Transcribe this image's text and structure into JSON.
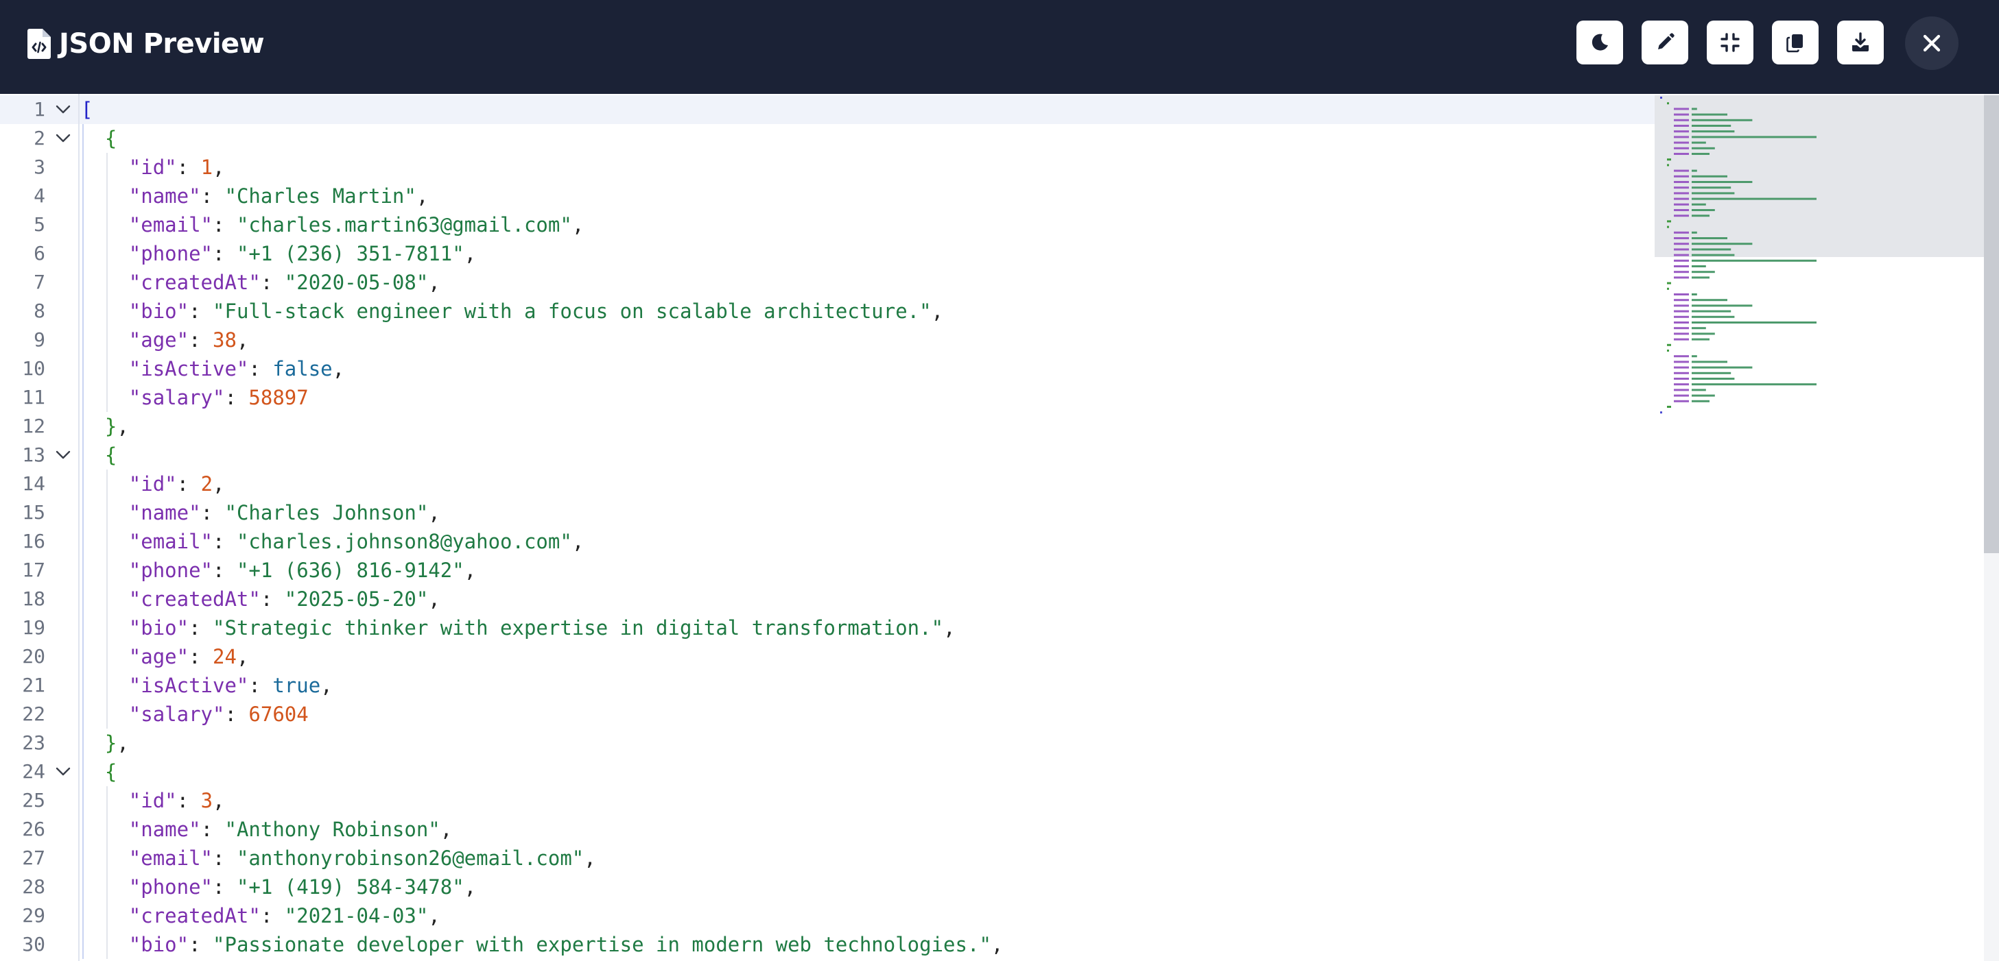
{
  "app": {
    "title": "JSON Preview"
  },
  "toolbar": [
    {
      "name": "theme-toggle-button",
      "icon": "moon-icon"
    },
    {
      "name": "edit-button",
      "icon": "pencil-icon"
    },
    {
      "name": "collapse-button",
      "icon": "compress-icon"
    },
    {
      "name": "copy-button",
      "icon": "copy-icon"
    },
    {
      "name": "download-button",
      "icon": "download-icon"
    }
  ],
  "close": {
    "icon": "close-icon"
  },
  "colors": {
    "header_bg": "#1b2236",
    "key": "#7b2fae",
    "string": "#1f7a43",
    "number": "#d2551c",
    "boolean": "#1a6a9a",
    "brace": "#2a8a2a",
    "bracket": "#2323c8"
  },
  "editor": {
    "lines": [
      {
        "n": "1",
        "fold": true,
        "tokens": [
          {
            "t": "bracket",
            "v": "["
          }
        ]
      },
      {
        "n": "2",
        "fold": true,
        "tokens": [
          {
            "t": "brace",
            "v": "{"
          }
        ]
      },
      {
        "n": "3",
        "tokens": [
          {
            "t": "key",
            "v": "\"id\""
          },
          {
            "t": "punc",
            "v": ": "
          },
          {
            "t": "num",
            "v": "1"
          },
          {
            "t": "punc",
            "v": ","
          }
        ]
      },
      {
        "n": "4",
        "tokens": [
          {
            "t": "key",
            "v": "\"name\""
          },
          {
            "t": "punc",
            "v": ": "
          },
          {
            "t": "str",
            "v": "\"Charles Martin\""
          },
          {
            "t": "punc",
            "v": ","
          }
        ]
      },
      {
        "n": "5",
        "tokens": [
          {
            "t": "key",
            "v": "\"email\""
          },
          {
            "t": "punc",
            "v": ": "
          },
          {
            "t": "str",
            "v": "\"charles.martin63@gmail.com\""
          },
          {
            "t": "punc",
            "v": ","
          }
        ]
      },
      {
        "n": "6",
        "tokens": [
          {
            "t": "key",
            "v": "\"phone\""
          },
          {
            "t": "punc",
            "v": ": "
          },
          {
            "t": "str",
            "v": "\"+1 (236) 351-7811\""
          },
          {
            "t": "punc",
            "v": ","
          }
        ]
      },
      {
        "n": "7",
        "tokens": [
          {
            "t": "key",
            "v": "\"createdAt\""
          },
          {
            "t": "punc",
            "v": ": "
          },
          {
            "t": "str",
            "v": "\"2020-05-08\""
          },
          {
            "t": "punc",
            "v": ","
          }
        ]
      },
      {
        "n": "8",
        "tokens": [
          {
            "t": "key",
            "v": "\"bio\""
          },
          {
            "t": "punc",
            "v": ": "
          },
          {
            "t": "str",
            "v": "\"Full-stack engineer with a focus on scalable architecture.\""
          },
          {
            "t": "punc",
            "v": ","
          }
        ]
      },
      {
        "n": "9",
        "tokens": [
          {
            "t": "key",
            "v": "\"age\""
          },
          {
            "t": "punc",
            "v": ": "
          },
          {
            "t": "num",
            "v": "38"
          },
          {
            "t": "punc",
            "v": ","
          }
        ]
      },
      {
        "n": "10",
        "tokens": [
          {
            "t": "key",
            "v": "\"isActive\""
          },
          {
            "t": "punc",
            "v": ": "
          },
          {
            "t": "bool",
            "v": "false"
          },
          {
            "t": "punc",
            "v": ","
          }
        ]
      },
      {
        "n": "11",
        "tokens": [
          {
            "t": "key",
            "v": "\"salary\""
          },
          {
            "t": "punc",
            "v": ": "
          },
          {
            "t": "num",
            "v": "58897"
          }
        ]
      },
      {
        "n": "12",
        "tokens": [
          {
            "t": "brace",
            "v": "}"
          },
          {
            "t": "punc",
            "v": ","
          }
        ]
      },
      {
        "n": "13",
        "fold": true,
        "tokens": [
          {
            "t": "brace",
            "v": "{"
          }
        ]
      },
      {
        "n": "14",
        "tokens": [
          {
            "t": "key",
            "v": "\"id\""
          },
          {
            "t": "punc",
            "v": ": "
          },
          {
            "t": "num",
            "v": "2"
          },
          {
            "t": "punc",
            "v": ","
          }
        ]
      },
      {
        "n": "15",
        "tokens": [
          {
            "t": "key",
            "v": "\"name\""
          },
          {
            "t": "punc",
            "v": ": "
          },
          {
            "t": "str",
            "v": "\"Charles Johnson\""
          },
          {
            "t": "punc",
            "v": ","
          }
        ]
      },
      {
        "n": "16",
        "tokens": [
          {
            "t": "key",
            "v": "\"email\""
          },
          {
            "t": "punc",
            "v": ": "
          },
          {
            "t": "str",
            "v": "\"charles.johnson8@yahoo.com\""
          },
          {
            "t": "punc",
            "v": ","
          }
        ]
      },
      {
        "n": "17",
        "tokens": [
          {
            "t": "key",
            "v": "\"phone\""
          },
          {
            "t": "punc",
            "v": ": "
          },
          {
            "t": "str",
            "v": "\"+1 (636) 816-9142\""
          },
          {
            "t": "punc",
            "v": ","
          }
        ]
      },
      {
        "n": "18",
        "tokens": [
          {
            "t": "key",
            "v": "\"createdAt\""
          },
          {
            "t": "punc",
            "v": ": "
          },
          {
            "t": "str",
            "v": "\"2025-05-20\""
          },
          {
            "t": "punc",
            "v": ","
          }
        ]
      },
      {
        "n": "19",
        "tokens": [
          {
            "t": "key",
            "v": "\"bio\""
          },
          {
            "t": "punc",
            "v": ": "
          },
          {
            "t": "str",
            "v": "\"Strategic thinker with expertise in digital transformation.\""
          },
          {
            "t": "punc",
            "v": ","
          }
        ]
      },
      {
        "n": "20",
        "tokens": [
          {
            "t": "key",
            "v": "\"age\""
          },
          {
            "t": "punc",
            "v": ": "
          },
          {
            "t": "num",
            "v": "24"
          },
          {
            "t": "punc",
            "v": ","
          }
        ]
      },
      {
        "n": "21",
        "tokens": [
          {
            "t": "key",
            "v": "\"isActive\""
          },
          {
            "t": "punc",
            "v": ": "
          },
          {
            "t": "bool",
            "v": "true"
          },
          {
            "t": "punc",
            "v": ","
          }
        ]
      },
      {
        "n": "22",
        "tokens": [
          {
            "t": "key",
            "v": "\"salary\""
          },
          {
            "t": "punc",
            "v": ": "
          },
          {
            "t": "num",
            "v": "67604"
          }
        ]
      },
      {
        "n": "23",
        "tokens": [
          {
            "t": "brace",
            "v": "}"
          },
          {
            "t": "punc",
            "v": ","
          }
        ]
      },
      {
        "n": "24",
        "fold": true,
        "tokens": [
          {
            "t": "brace",
            "v": "{"
          }
        ]
      },
      {
        "n": "25",
        "tokens": [
          {
            "t": "key",
            "v": "\"id\""
          },
          {
            "t": "punc",
            "v": ": "
          },
          {
            "t": "num",
            "v": "3"
          },
          {
            "t": "punc",
            "v": ","
          }
        ]
      },
      {
        "n": "26",
        "tokens": [
          {
            "t": "key",
            "v": "\"name\""
          },
          {
            "t": "punc",
            "v": ": "
          },
          {
            "t": "str",
            "v": "\"Anthony Robinson\""
          },
          {
            "t": "punc",
            "v": ","
          }
        ]
      },
      {
        "n": "27",
        "tokens": [
          {
            "t": "key",
            "v": "\"email\""
          },
          {
            "t": "punc",
            "v": ": "
          },
          {
            "t": "str",
            "v": "\"anthonyrobinson26@email.com\""
          },
          {
            "t": "punc",
            "v": ","
          }
        ]
      },
      {
        "n": "28",
        "tokens": [
          {
            "t": "key",
            "v": "\"phone\""
          },
          {
            "t": "punc",
            "v": ": "
          },
          {
            "t": "str",
            "v": "\"+1 (419) 584-3478\""
          },
          {
            "t": "punc",
            "v": ","
          }
        ]
      },
      {
        "n": "29",
        "tokens": [
          {
            "t": "key",
            "v": "\"createdAt\""
          },
          {
            "t": "punc",
            "v": ": "
          },
          {
            "t": "str",
            "v": "\"2021-04-03\""
          },
          {
            "t": "punc",
            "v": ","
          }
        ]
      },
      {
        "n": "30",
        "tokens": [
          {
            "t": "key",
            "v": "\"bio\""
          },
          {
            "t": "punc",
            "v": ": "
          },
          {
            "t": "str",
            "v": "\"Passionate developer with expertise in modern web technologies.\""
          },
          {
            "t": "punc",
            "v": ","
          }
        ]
      }
    ]
  }
}
